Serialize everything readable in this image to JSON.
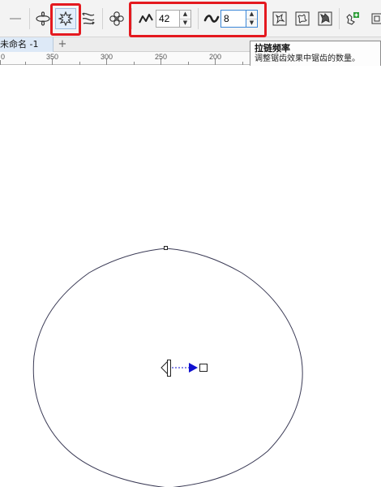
{
  "toolbar": {
    "tools": [
      {
        "icon": "minus-icon"
      },
      {
        "icon": "push-distortion-icon"
      },
      {
        "icon": "zipper-distortion-icon",
        "selected": true
      },
      {
        "icon": "twister-distortion-icon"
      },
      {
        "icon": "center-distortion-icon"
      },
      {
        "icon": "distortion-preset-1-icon"
      },
      {
        "icon": "distortion-preset-2-icon"
      },
      {
        "icon": "distortion-preset-3-icon"
      },
      {
        "icon": "add-new-distortion-icon"
      }
    ],
    "amplitude": {
      "icon": "zipper-amplitude-icon",
      "value": "42"
    },
    "frequency": {
      "icon": "zipper-frequency-icon",
      "value": "8"
    }
  },
  "document": {
    "tab_label": "未命名 -1",
    "add_tab": "+"
  },
  "ruler": {
    "labels": [
      "0",
      "350",
      "300",
      "250",
      "200"
    ]
  },
  "tooltip": {
    "title": "拉链频率",
    "body": "调整锯齿效果中锯齿的数量。"
  },
  "colors": {
    "highlight": "#e4191f",
    "handle_arrow": "#1010d0",
    "shape_outline": "#3a3a55"
  }
}
